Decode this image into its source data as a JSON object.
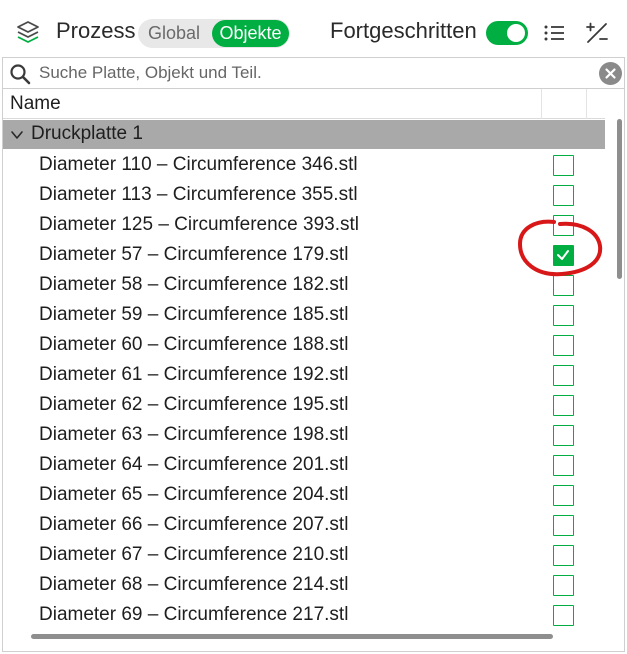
{
  "toolbar": {
    "title": "Prozess",
    "segment": {
      "global_label": "Global",
      "objects_label": "Objekte",
      "selected": "Objekte"
    },
    "advanced_label": "Fortgeschritten",
    "advanced_enabled": true,
    "icons": [
      "layers-icon",
      "list-icon",
      "percent-icon"
    ]
  },
  "search": {
    "placeholder": "Suche Platte, Objekt und Teil.",
    "value": ""
  },
  "table": {
    "column_name": "Name",
    "group": {
      "label": "Druckplatte 1",
      "expanded": true
    },
    "rows": [
      {
        "label": "Diameter 110 – Circumference 346.stl",
        "checked": false
      },
      {
        "label": "Diameter 113 – Circumference 355.stl",
        "checked": false
      },
      {
        "label": "Diameter 125 – Circumference 393.stl",
        "checked": false
      },
      {
        "label": "Diameter 57 – Circumference 179.stl",
        "checked": true
      },
      {
        "label": "Diameter 58 – Circumference 182.stl",
        "checked": false
      },
      {
        "label": "Diameter 59 – Circumference 185.stl",
        "checked": false
      },
      {
        "label": "Diameter 60 – Circumference 188.stl",
        "checked": false
      },
      {
        "label": "Diameter 61 – Circumference 192.stl",
        "checked": false
      },
      {
        "label": "Diameter 62 – Circumference 195.stl",
        "checked": false
      },
      {
        "label": "Diameter 63 – Circumference 198.stl",
        "checked": false
      },
      {
        "label": "Diameter 64 – Circumference 201.stl",
        "checked": false
      },
      {
        "label": "Diameter 65 – Circumference 204.stl",
        "checked": false
      },
      {
        "label": "Diameter 66 – Circumference 207.stl",
        "checked": false
      },
      {
        "label": "Diameter 67 – Circumference 210.stl",
        "checked": false
      },
      {
        "label": "Diameter 68 – Circumference 214.stl",
        "checked": false
      },
      {
        "label": "Diameter 69 – Circumference 217.stl",
        "checked": false
      }
    ]
  },
  "colors": {
    "accent": "#00ae42",
    "group_row": "#a9a9a9",
    "annotation": "#d81818",
    "scrollbar": "#8e8e8e"
  }
}
